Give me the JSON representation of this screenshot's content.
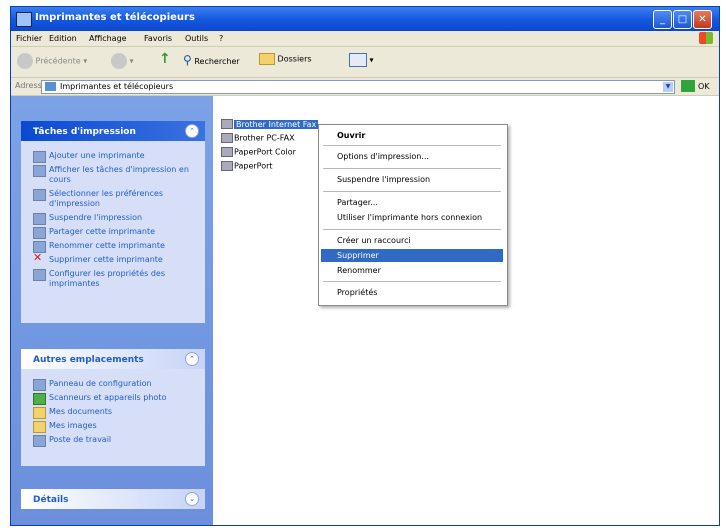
{
  "window": {
    "title": "Imprimantes et télécopieurs",
    "buttons": [
      "_",
      "□",
      "✕"
    ]
  },
  "menubar": [
    "Fichier",
    "Edition",
    "Affichage",
    "Favoris",
    "Outils",
    "?"
  ],
  "toolbar": {
    "back": "Précédente",
    "search": "Rechercher",
    "folders": "Dossiers"
  },
  "address": {
    "label": "Adresse",
    "value": "Imprimantes et télécopieurs",
    "go": "OK"
  },
  "sidebar": {
    "print_tasks": {
      "title": "Tâches d'impression",
      "items": [
        "Ajouter une imprimante",
        "Afficher les tâches d'impression en cours",
        "Sélectionner les préférences d'impression",
        "Suspendre l'impression",
        "Partager cette imprimante",
        "Renommer cette imprimante",
        "Supprimer cette imprimante",
        "Configurer les propriétés des imprimantes"
      ]
    },
    "other_places": {
      "title": "Autres emplacements",
      "items": [
        "Panneau de configuration",
        "Scanneurs et appareils photo",
        "Mes documents",
        "Mes images",
        "Poste de travail"
      ]
    },
    "details": {
      "title": "Détails"
    }
  },
  "printers": [
    "Brother Internet Fax",
    "Brother PC-FAX",
    "PaperPort Color",
    "PaperPort"
  ],
  "context_menu": {
    "items": [
      "Ouvrir",
      "Options d'impression...",
      "Suspendre l'impression",
      "Partager...",
      "Utiliser l'imprimante hors connexion",
      "Créer un raccourci",
      "Supprimer",
      "Renommer",
      "Propriétés"
    ],
    "highlighted": "Supprimer"
  }
}
